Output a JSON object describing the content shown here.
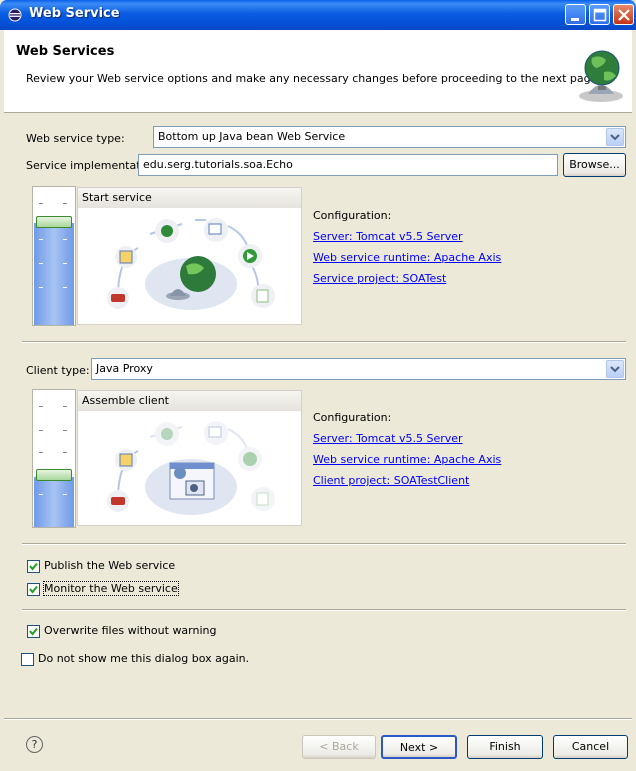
{
  "window": {
    "title": "Web Service"
  },
  "banner": {
    "title": "Web Services",
    "description": "Review your Web service options and make any necessary changes before proceeding to the next page."
  },
  "service": {
    "type_label": "Web service type:",
    "type_value": "Bottom up Java bean Web Service",
    "impl_label": "Service implementation:",
    "impl_value": "edu.serg.tutorials.soa.Echo",
    "browse_label": "Browse...",
    "panel_title": "Start service",
    "config_label": "Configuration:",
    "links": [
      "Server: Tomcat v5.5 Server",
      "Web service runtime: Apache Axis",
      "Service project: SOATest"
    ],
    "slider_level": "Start service"
  },
  "client": {
    "type_label": "Client type:",
    "type_value": "Java Proxy",
    "panel_title": "Assemble client",
    "config_label": "Configuration:",
    "links": [
      "Server: Tomcat v5.5 Server",
      "Web service runtime: Apache Axis",
      "Client project: SOATestClient"
    ],
    "slider_level": "Assemble client"
  },
  "options": [
    {
      "label": "Publish the Web service",
      "checked": true
    },
    {
      "label": "Monitor the Web service",
      "checked": true
    },
    {
      "label": "Overwrite files without warning",
      "checked": true
    },
    {
      "label": "Do not show me this dialog box again.",
      "checked": false
    }
  ],
  "buttons": {
    "help": "?",
    "back": "< Back",
    "next": "Next >",
    "finish": "Finish",
    "cancel": "Cancel"
  },
  "colors": {
    "titlebar": "#0a5de3",
    "link": "#0000ff",
    "dialog_bg": "#ece9d8"
  }
}
